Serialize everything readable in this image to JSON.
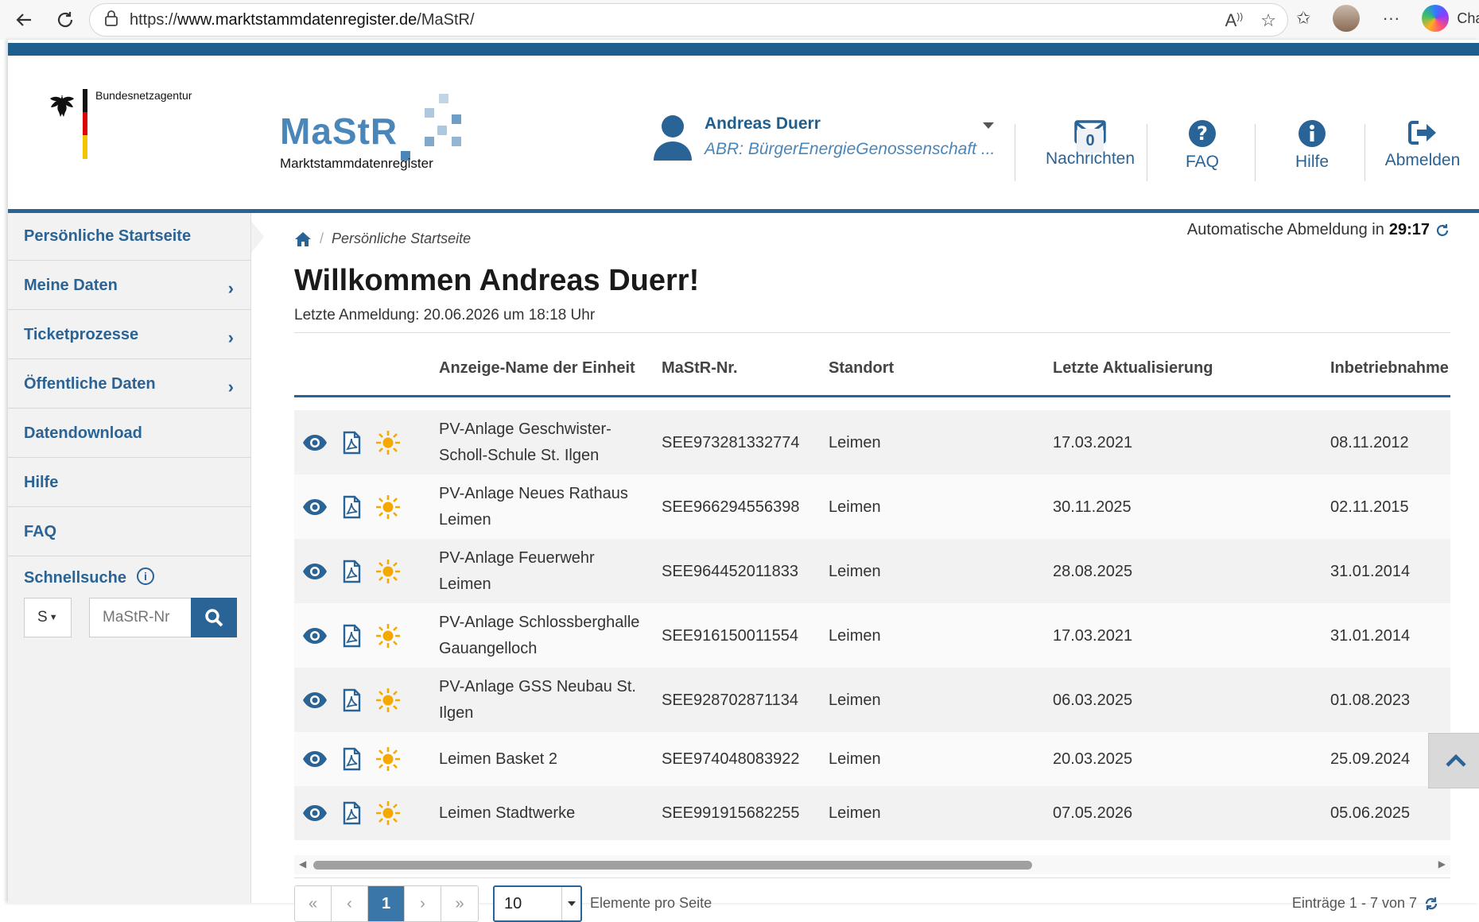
{
  "browser": {
    "url_prefix": "https://",
    "url_host": "www.marktstammdatenregister.de",
    "url_path": "/MaStR/",
    "chat_label": "Chat"
  },
  "header": {
    "agency_name": "Bundesnetzagentur",
    "logo_word": "MaStR",
    "logo_sub": "Marktstammdatenregister",
    "user_name": "Andreas Duerr",
    "user_org": "ABR: BürgerEnergieGenossenschaft ...",
    "messages_label": "Nachrichten",
    "messages_count": "0",
    "faq_label": "FAQ",
    "help_label": "Hilfe",
    "logout_label": "Abmelden"
  },
  "sidebar": {
    "items": [
      {
        "label": "Persönliche Startseite"
      },
      {
        "label": "Meine Daten"
      },
      {
        "label": "Ticketprozesse"
      },
      {
        "label": "Öffentliche Daten"
      },
      {
        "label": "Datendownload"
      },
      {
        "label": "Hilfe"
      },
      {
        "label": "FAQ"
      }
    ],
    "quicksearch_title": "Schnellsuche",
    "quicksearch_select": "S",
    "quicksearch_placeholder": "MaStR-Nr"
  },
  "main": {
    "breadcrumb": "Persönliche Startseite",
    "auto_logout_text": "Automatische Abmeldung in",
    "auto_logout_time": "29:17",
    "welcome": "Willkommen Andreas Duerr!",
    "last_login": "Letzte Anmeldung: 20.06.2026 um 18:18 Uhr",
    "table": {
      "headers": [
        "Anzeige-Name der Einheit",
        "MaStR-Nr.",
        "Standort",
        "Letzte Aktualisierung",
        "Inbetriebnahme"
      ],
      "rows": [
        {
          "name1": "PV-Anlage Geschwister-",
          "name2": "Scholl-Schule St. Ilgen",
          "nr": "SEE973281332774",
          "ort": "Leimen",
          "update": "17.03.2021",
          "start": "08.11.2012"
        },
        {
          "name1": "PV-Anlage Neues Rathaus",
          "name2": "Leimen",
          "nr": "SEE966294556398",
          "ort": "Leimen",
          "update": "30.11.2025",
          "start": "02.11.2015"
        },
        {
          "name1": "PV-Anlage Feuerwehr",
          "name2": "Leimen",
          "nr": "SEE964452011833",
          "ort": "Leimen",
          "update": "28.08.2025",
          "start": "31.01.2014"
        },
        {
          "name1": "PV-Anlage Schlossberghalle",
          "name2": "Gauangelloch",
          "nr": "SEE916150011554",
          "ort": "Leimen",
          "update": "17.03.2021",
          "start": "31.01.2014"
        },
        {
          "name1": "PV-Anlage GSS Neubau St.",
          "name2": "Ilgen",
          "nr": "SEE928702871134",
          "ort": "Leimen",
          "update": "06.03.2025",
          "start": "01.08.2023"
        },
        {
          "name1": "Leimen Basket 2",
          "name2": "",
          "nr": "SEE974048083922",
          "ort": "Leimen",
          "update": "20.03.2025",
          "start": "25.09.2024"
        },
        {
          "name1": "Leimen Stadtwerke",
          "name2": "",
          "nr": "SEE991915682255",
          "ort": "Leimen",
          "update": "07.05.2026",
          "start": "05.06.2025"
        }
      ]
    },
    "pager": {
      "first": "«",
      "prev": "‹",
      "current": "1",
      "next": "›",
      "last": "»",
      "per_page_value": "10",
      "per_page_label": "Elemente pro Seite",
      "entries": "Einträge 1 - 7 von 7"
    }
  },
  "colors": {
    "brand": "#2a6396",
    "accent_light": "#4a86b8",
    "sun_icon": "#f5a800"
  }
}
